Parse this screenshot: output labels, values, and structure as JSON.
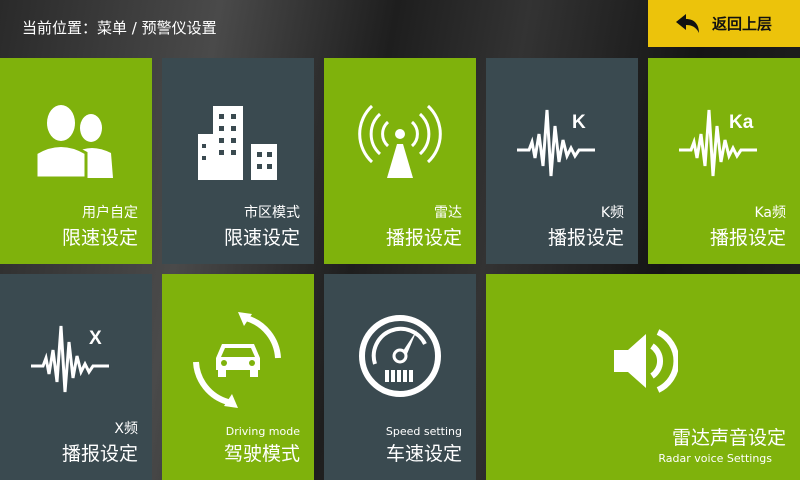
{
  "header": {
    "breadcrumb": "当前位置：菜单 / 预警仪设置",
    "back_label": "返回上层",
    "back_color": "#ecc30b"
  },
  "colors": {
    "green": "#7fb20c",
    "dark": "#3a4a50"
  },
  "tiles": [
    {
      "line1": "用户自定",
      "line2": "限速设定",
      "icon": "users-icon"
    },
    {
      "line1": "市区模式",
      "line2": "限速设定",
      "icon": "city-buildings-icon"
    },
    {
      "line1": "雷达",
      "line2": "播报设定",
      "icon": "radar-antenna-icon"
    },
    {
      "line1": "K频",
      "line2": "播报设定",
      "icon": "k-band-wave-icon",
      "badge": "K"
    },
    {
      "line1": "Ka频",
      "line2": "播报设定",
      "icon": "ka-band-wave-icon",
      "badge": "Ka"
    },
    {
      "line1": "X频",
      "line2": "播报设定",
      "icon": "x-band-wave-icon",
      "badge": "X"
    },
    {
      "line1": "Driving mode",
      "line2": "驾驶模式",
      "icon": "car-cycle-icon"
    },
    {
      "line1": "Speed setting",
      "line2": "车速设定",
      "icon": "speedometer-icon"
    },
    {
      "line1": "雷达声音设定",
      "line2": "Radar voice Settings",
      "icon": "speaker-icon"
    }
  ]
}
